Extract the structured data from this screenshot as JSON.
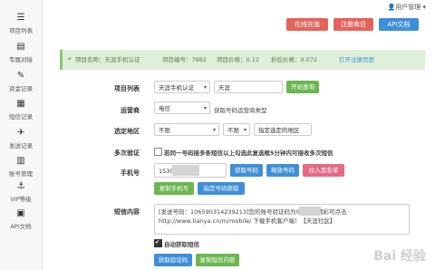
{
  "header": {
    "user_menu": "用户管理",
    "buttons": [
      {
        "label": "在线充值",
        "color": "#e3645b"
      },
      {
        "label": "注册商目",
        "color": "#e3645b"
      },
      {
        "label": "API文档",
        "color": "#3f8fd8"
      }
    ]
  },
  "sidebar": {
    "items": [
      {
        "label": "项目列表",
        "icon": "list-icon"
      },
      {
        "label": "专属对接",
        "icon": "table-icon"
      },
      {
        "label": "资金记录",
        "icon": "pencil-icon"
      },
      {
        "label": "短信记录",
        "icon": "grid-icon"
      },
      {
        "label": "发送记录",
        "icon": "send-icon"
      },
      {
        "label": "账号管理",
        "icon": "chart-icon"
      },
      {
        "label": "VIP等级",
        "icon": "anchor-icon"
      },
      {
        "label": "API文档",
        "icon": "doc-icon"
      }
    ]
  },
  "project_info": {
    "name": "项目名称：天涯手机认证",
    "number": "项目编号：7982",
    "price": "项目价格：0.12",
    "discount_price": "折后价格：0.072",
    "register_link": "打开注册页面"
  },
  "form": {
    "project_list": {
      "label": "项目列表",
      "select_value": "天涯手机认证",
      "input_value": "天涯",
      "button": "开始查询"
    },
    "operator": {
      "label": "运营商",
      "select_value": "电信",
      "hint": "获取号码运营商类型"
    },
    "region": {
      "label": "选定地区",
      "province": "不限",
      "city": "不限",
      "button": "指定选定的地区"
    },
    "multi_verify": {
      "label": "多次验证",
      "text": "若同一号码接多条短信以上勾选此复选框5分钟内可接收多次短信",
      "checked": false
    },
    "phone": {
      "label": "手机号",
      "value": "1530",
      "buttons": [
        {
          "label": "获取号码",
          "color": "#3f8fd8"
        },
        {
          "label": "释放号码",
          "color": "#3f8fd8"
        },
        {
          "label": "拉入黑名单",
          "color": "#e46a86"
        }
      ],
      "copy_button": "复制手机号",
      "specify_button": "指定号码获取"
    },
    "sms": {
      "label": "短信内容",
      "content": "[发送号码：106590314239213]您的账号验证码为06   更多精彩可点击 http://www.tianya.cn/m/mobile/ 下载手机客户端！【天涯社区】",
      "auto_label": "自动获取短信",
      "auto_checked": true,
      "get_button": "获取验证码",
      "copy_button": "复制短信内容"
    }
  },
  "watermark": "Bai 经验"
}
